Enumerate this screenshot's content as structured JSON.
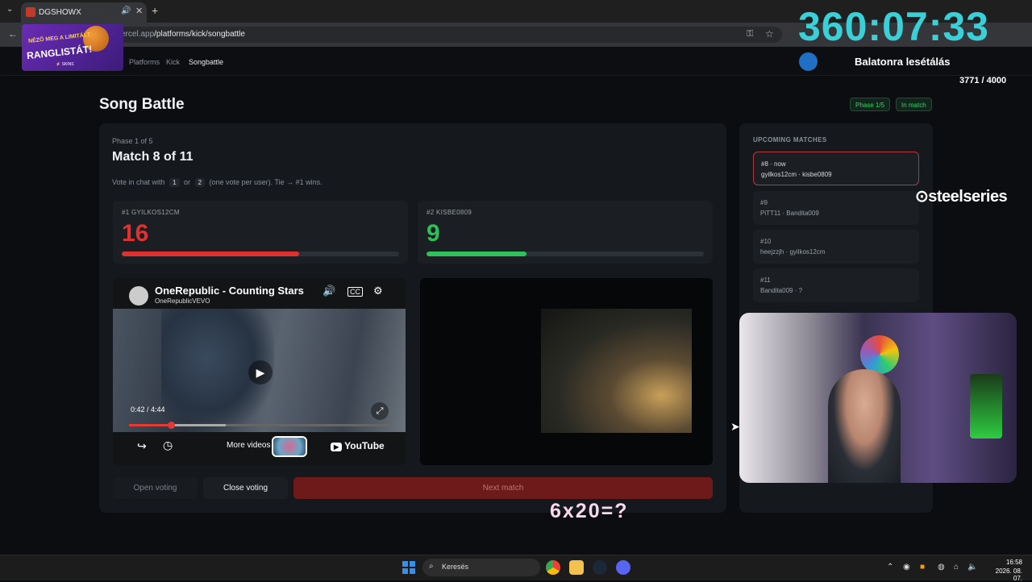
{
  "browser": {
    "tab_title": "DGSHOWX",
    "url_host": "ercel.app",
    "url_path": "/platforms/kick/songbattle"
  },
  "nav": {
    "breadcrumbs": [
      "Platforms",
      "Kick",
      "Songbattle"
    ]
  },
  "page": {
    "title": "Song Battle",
    "badges": [
      "Phase 1/5",
      "In match"
    ]
  },
  "match": {
    "phase_label": "Phase 1 of 5",
    "title": "Match 8 of 11",
    "hint_prefix": "Vote in chat with",
    "key1": "1",
    "hint_or": "or",
    "key2": "2",
    "hint_suffix": "(one vote per user). Tie → #1 wins."
  },
  "contestants": [
    {
      "label": "#1 GYILKOS12CM",
      "votes": "16",
      "share": 0.64,
      "color": "#e03131"
    },
    {
      "label": "#2 KISBE0809",
      "votes": "9",
      "share": 0.36,
      "color": "#2fbf5b"
    }
  ],
  "video1": {
    "title": "OneRepublic - Counting Stars",
    "channel": "OneRepublicVEVO",
    "time": "0:42 / 4:44",
    "progress": 0.16,
    "buffered": 0.37,
    "more_videos": "More videos",
    "logo": "YouTube"
  },
  "actions": {
    "open_voting": "Open voting",
    "close_voting": "Close voting",
    "next_match": "Next match"
  },
  "upcoming": {
    "heading": "UPCOMING MATCHES",
    "items": [
      {
        "num": "#8 · now",
        "pair": "gyilkos12cm · kisbe0809"
      },
      {
        "num": "#9",
        "pair": "PiTT11 · Bandita009"
      },
      {
        "num": "#10",
        "pair": "heejzzjh · gyilkos12cm"
      },
      {
        "num": "#11",
        "pair": "Bandita009 · ?"
      }
    ]
  },
  "overlay": {
    "timer": "360:07:33",
    "goal_title": "Balatonra lesétálás",
    "goal_count": "3771 / 4000",
    "ad_line1": "NÉZŐ MEG A LIMITÁLT",
    "ad_line2": "RANGLISTÁT!",
    "ad_brand": "⚡ SKINS",
    "sponsor": "steelseries",
    "math": "6x20=?"
  },
  "taskbar": {
    "search_placeholder": "Keresés",
    "time": "16:58",
    "date": "2026. 08. 07."
  }
}
